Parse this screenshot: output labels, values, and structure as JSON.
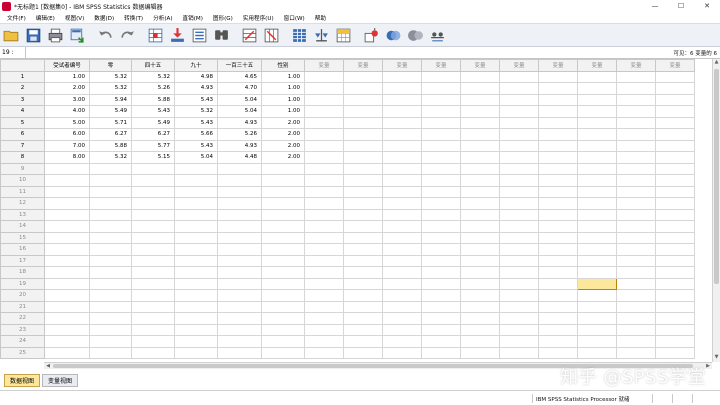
{
  "window": {
    "title": "*无标题1 [数据集0] - IBM SPSS Statistics 数据编辑器",
    "minimize": "—",
    "maximize": "☐",
    "close": "✕"
  },
  "menu": [
    "文件(F)",
    "编辑(E)",
    "视图(V)",
    "数据(D)",
    "转换(T)",
    "分析(A)",
    "直销(M)",
    "图形(G)",
    "实用程序(U)",
    "窗口(W)",
    "帮助"
  ],
  "toolbar": {
    "icons": [
      "open-icon",
      "save-icon",
      "print-icon",
      "dialog-recall-icon",
      "undo-icon",
      "redo-icon",
      "goto-case-icon",
      "goto-variable-icon",
      "variables-icon",
      "find-icon",
      "insert-cases-icon",
      "insert-variable-icon",
      "split-file-icon",
      "weight-cases-icon",
      "select-cases-icon",
      "value-labels-icon",
      "use-variable-sets-icon",
      "show-all-variables-icon",
      "spell-check-icon"
    ]
  },
  "cell_editor": {
    "reference": "19 :",
    "visible_count": "可见：6 变量的 6"
  },
  "grid": {
    "columns": [
      "受试者编号",
      "零",
      "四十五",
      "九十",
      "一百三十五",
      "性别",
      "变量",
      "变量",
      "变量",
      "变量",
      "变量",
      "变量",
      "变量",
      "变量",
      "变量",
      "变量"
    ],
    "rows": [
      [
        "1.00",
        "5.32",
        "5.32",
        "4.98",
        "4.65",
        "1.00"
      ],
      [
        "2.00",
        "5.32",
        "5.26",
        "4.93",
        "4.70",
        "1.00"
      ],
      [
        "3.00",
        "5.94",
        "5.88",
        "5.43",
        "5.04",
        "1.00"
      ],
      [
        "4.00",
        "5.49",
        "5.43",
        "5.32",
        "5.04",
        "1.00"
      ],
      [
        "5.00",
        "5.71",
        "5.49",
        "5.43",
        "4.93",
        "2.00"
      ],
      [
        "6.00",
        "6.27",
        "6.27",
        "5.66",
        "5.26",
        "2.00"
      ],
      [
        "7.00",
        "5.88",
        "5.77",
        "5.43",
        "4.93",
        "2.00"
      ],
      [
        "8.00",
        "5.32",
        "5.15",
        "5.04",
        "4.48",
        "2.00"
      ]
    ],
    "row_numbers": [
      "1",
      "2",
      "3",
      "4",
      "5",
      "6",
      "7",
      "8",
      "9",
      "10",
      "11",
      "12",
      "13",
      "14",
      "15",
      "16",
      "17",
      "18",
      "19",
      "20",
      "21",
      "22",
      "23",
      "24",
      "25"
    ],
    "selected_cell": {
      "row": 19,
      "column": 14
    }
  },
  "tabs": {
    "data_view": "数据视图",
    "variable_view": "变量视图"
  },
  "status": {
    "processor": "IBM SPSS Statistics Processor 就绪"
  },
  "watermark": "知乎 @SPSS学堂",
  "colors": {
    "selected_cell": "#fde79a",
    "active_tab": "#fde79a",
    "toolbar_bg": "#eef1f6"
  }
}
